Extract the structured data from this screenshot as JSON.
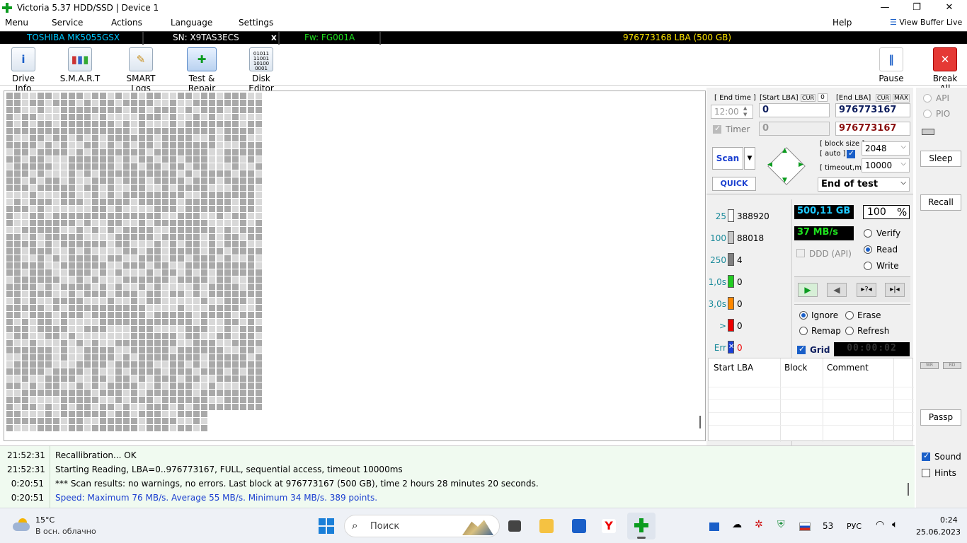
{
  "window": {
    "title": "Victoria 5.37 HDD/SSD | Device 1",
    "minimize": "—",
    "maximize": "❐",
    "close": "✕"
  },
  "menu": {
    "items": [
      "Menu",
      "Service",
      "Actions",
      "Language",
      "Settings"
    ],
    "help": "Help",
    "view_buffer": "View Buffer Live"
  },
  "device": {
    "model": "TOSHIBA MK5055GSX",
    "serial": "SN: X9TAS3ECS",
    "x": "x",
    "firmware": "Fw: FG001A",
    "lba": "976773168 LBA (500 GB)"
  },
  "toolbar": {
    "drive_info": "Drive Info",
    "smart": "S.M.A.R.T",
    "smart_logs": "SMART Logs",
    "test_repair": "Test & Repair",
    "disk_editor": "Disk Editor",
    "pause": "Pause",
    "break_all": "Break All"
  },
  "scan": {
    "end_time_label": "[ End time ]",
    "start_lba_label": "[Start LBA]",
    "cur": "CUR",
    "cur_value": "0",
    "end_lba_label": "[End LBA]",
    "cur2": "CUR",
    "max": "MAX",
    "end_time": "12:00",
    "start_lba": "0",
    "end_lba": "976773167",
    "timer_label": "Timer",
    "timer_value": "0",
    "end_lba_2": "976773167",
    "scan_button": "Scan",
    "quick_button": "QUICK",
    "block_size_label": "[ block size ]",
    "auto_label": "[ auto ]",
    "block_size": "2048",
    "timeout_label": "[ timeout,ms ]",
    "timeout": "10000",
    "end_of_test": "End of test"
  },
  "stats": {
    "rows": [
      {
        "label": "25",
        "value": "388920",
        "color": "#ffffff"
      },
      {
        "label": "100",
        "value": "88018",
        "color": "#c8c8c8"
      },
      {
        "label": "250",
        "value": "4",
        "color": "#808080"
      },
      {
        "label": "1,0s",
        "value": "0",
        "color": "#22cc22"
      },
      {
        "label": "3,0s",
        "value": "0",
        "color": "#ff8800"
      },
      {
        "label": ">",
        "value": "0",
        "color": "#ee0000"
      },
      {
        "label": "Err",
        "value": "0",
        "color": "#1a3fd8"
      }
    ],
    "size": "500,11 GB",
    "percent": "100",
    "percent_sign": "%",
    "speed": "37 MB/s",
    "ddd": "DDD (API)",
    "verify": "Verify",
    "read": "Read",
    "write": "Write",
    "ignore": "Ignore",
    "erase": "Erase",
    "remap": "Remap",
    "refresh": "Refresh",
    "grid": "Grid",
    "timer_display": "00:00:02"
  },
  "table": {
    "headers": [
      "Start LBA",
      "Block",
      "Comment"
    ]
  },
  "side": {
    "api": "API",
    "pio": "PIO",
    "sleep": "Sleep",
    "recall": "Recall",
    "wr": "WR",
    "rd": "RD",
    "passp": "Passp",
    "sound": "Sound",
    "hints": "Hints"
  },
  "log": [
    {
      "time": "21:52:31",
      "msg": "Recallibration... OK",
      "color": "#000000"
    },
    {
      "time": "21:52:31",
      "msg": "Starting Reading, LBA=0..976773167, FULL, sequential access, timeout 10000ms",
      "color": "#000000"
    },
    {
      "time": "0:20:51",
      "msg": "*** Scan results: no warnings, no errors. Last block at 976773167 (500 GB), time 2 hours 28 minutes 20 seconds.",
      "color": "#000000"
    },
    {
      "time": "0:20:51",
      "msg": "Speed: Maximum 76 MB/s. Average 55 MB/s. Minimum 34 MB/s. 389 points.",
      "color": "#1a3fd0"
    }
  ],
  "taskbar": {
    "temp": "15°C",
    "weather": "В осн. облачно",
    "search": "Поиск",
    "lang": "РУС",
    "badge": "53",
    "time": "0:24",
    "date": "25.06.2023"
  }
}
